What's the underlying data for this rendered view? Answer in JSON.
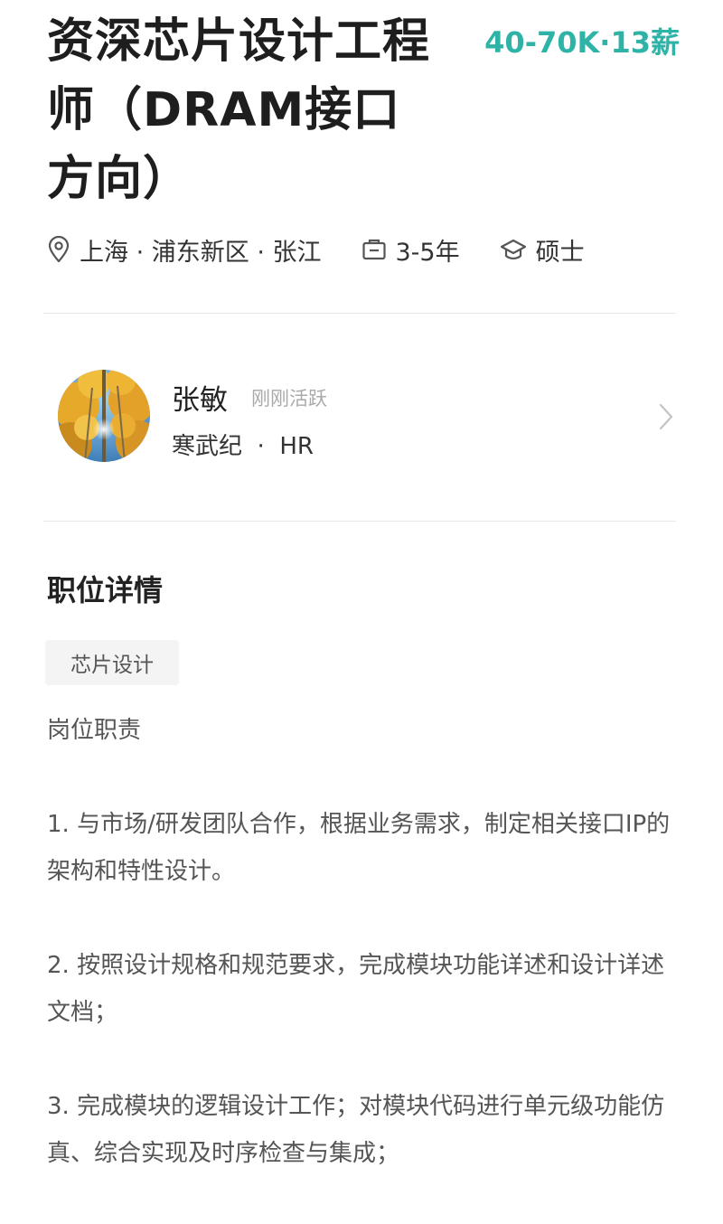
{
  "job": {
    "title": "资深芯片设计工程师（DRAM接口方向）",
    "salary": "40-70K·13薪",
    "location": "上海 · 浦东新区 · 张江",
    "experience": "3-5年",
    "education": "硕士"
  },
  "recruiter": {
    "name": "张敏",
    "status": "刚刚活跃",
    "company_role": "寒武纪  ·  HR"
  },
  "detail": {
    "section_title": "职位详情",
    "tag": "芯片设计",
    "heading": "岗位职责",
    "items": [
      "1. 与市场/研发团队合作，根据业务需求，制定相关接口IP的架构和特性设计。",
      "2. 按照设计规格和规范要求，完成模块功能详述和设计详述文档；",
      "3. 完成模块的逻辑设计工作；对模块代码进行单元级功能仿真、综合实现及时序检查与集成；"
    ]
  },
  "icons": {
    "location": "location-pin-icon",
    "experience": "briefcase-icon",
    "education": "graduation-cap-icon",
    "arrow": "chevron-right-icon"
  },
  "colors": {
    "salary": "#2fb3a6",
    "status": "#a9a9a9",
    "tag_bg": "#f4f4f4"
  }
}
